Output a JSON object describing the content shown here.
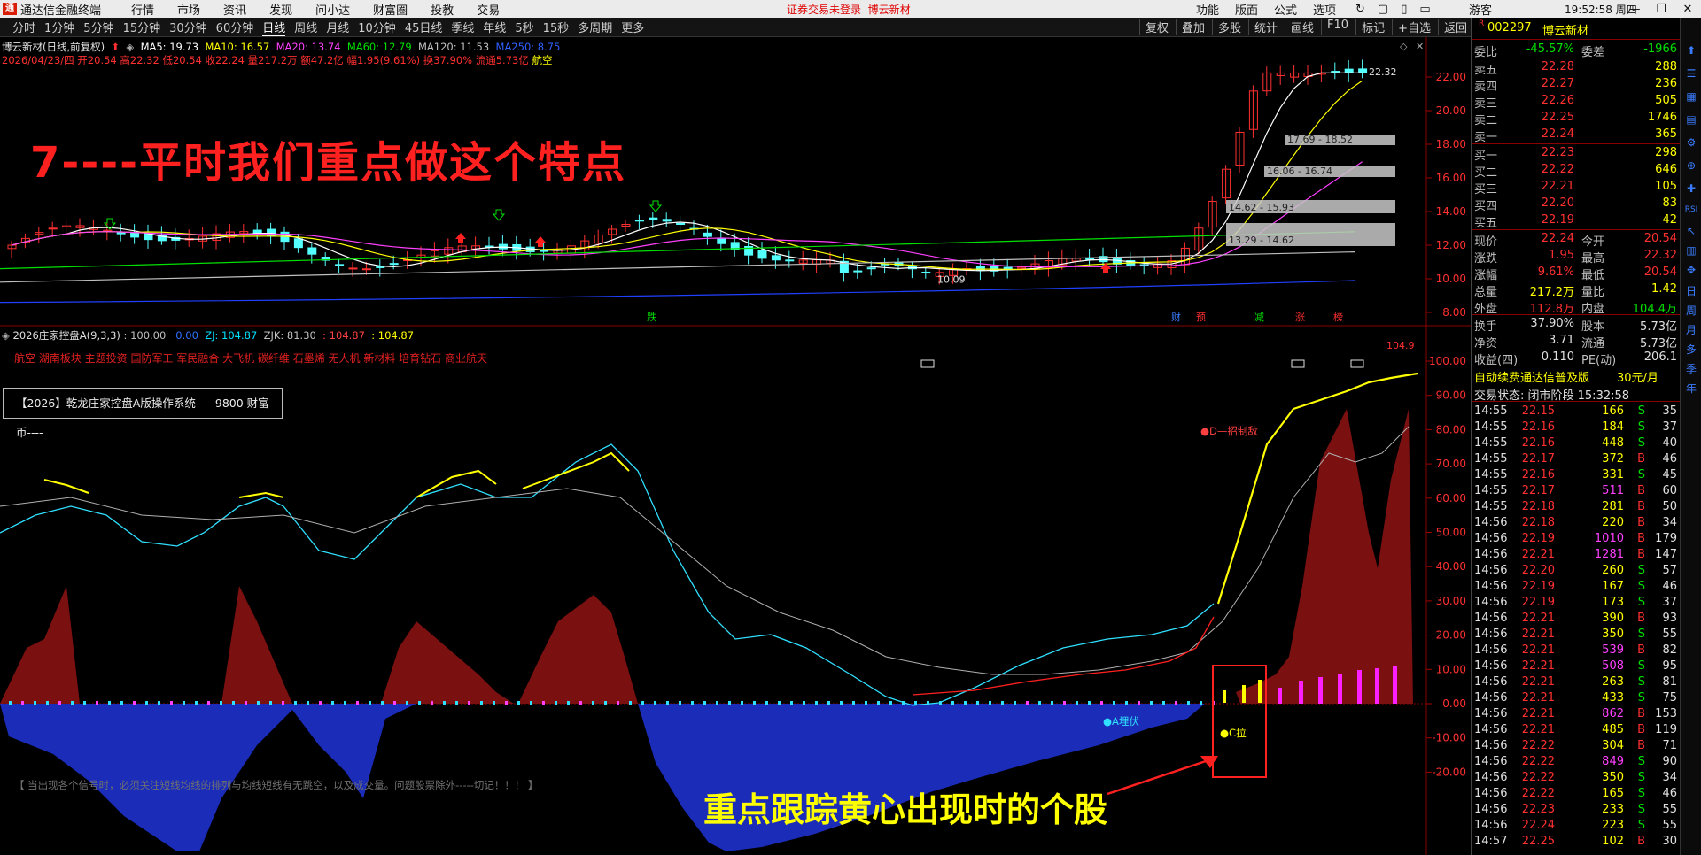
{
  "titlebar": {
    "app_name": "通达信金融终端",
    "menus": [
      "行情",
      "市场",
      "资讯",
      "发现",
      "问小达",
      "财富圈",
      "投教",
      "交易"
    ],
    "warning": "证券交易未登录",
    "stock_link": "博云新材",
    "right_menus": [
      "功能",
      "版面",
      "公式",
      "选项"
    ],
    "guest": "游客",
    "clock": "19:52:58 周四"
  },
  "periodbar": {
    "periods": [
      "分时",
      "1分钟",
      "5分钟",
      "15分钟",
      "30分钟",
      "60分钟",
      "日线",
      "周线",
      "月线",
      "10分钟",
      "45日线",
      "季线",
      "年线",
      "5秒",
      "15秒",
      "多周期",
      "更多"
    ],
    "active": "日线",
    "right_buttons": [
      "复权",
      "叠加",
      "多股",
      "统计",
      "画线",
      "F10",
      "标记",
      "+自选",
      "返回"
    ]
  },
  "main_chart": {
    "stock_title": "博云新材(日线,前复权)",
    "ma_labels": [
      "MA5: 19.73",
      "MA10: 16.57",
      "MA20: 13.74",
      "MA60: 12.79",
      "MA120: 11.53",
      "MA250: 8.75"
    ],
    "ma_colors": [
      "#ffffff",
      "#ffff00",
      "#ff40ff",
      "#00e000",
      "#c0c0c0",
      "#3060ff"
    ],
    "bar_info": "2026/04/23/四 开20.54 高22.32 低20.54 收22.24 量217.2万 额47.2亿 幅1.95(9.61%) 换37.90% 流通5.73亿",
    "bar_info_tag": "航空",
    "price_ticks": [
      "22.00",
      "20.00",
      "18.00",
      "16.00",
      "14.00",
      "12.00",
      "10.00",
      "8.00"
    ],
    "price_ticks_values": [
      22,
      20,
      18,
      16,
      14,
      12,
      10,
      8
    ],
    "high_label": "22.32",
    "low_label": "10.09",
    "chip_zones": [
      "17.69 - 18.52",
      "16.06 - 16.74",
      "14.62 - 15.93",
      "13.29 - 14.62"
    ],
    "event_tags": [
      "跌",
      "财",
      "预",
      "减",
      "涨",
      "榜"
    ],
    "big_title": "7----平时我们重点做这个特点"
  },
  "indicator": {
    "name": "2026庄家控盘A(9,3,3)",
    "values": [
      ": 100.00",
      "0.00",
      "ZJ: 104.87",
      "ZJK: 81.30",
      ": 104.87",
      ": 104.87"
    ],
    "value_colors": [
      "#c0c0c0",
      "#3070ff",
      "#00e0ff",
      "#c0c0c0",
      "#ff4040",
      "#ffff00"
    ],
    "concepts": "航空 湖南板块 主题投资 国防军工 军民融合 大飞机 碳纤维 石墨烯 无人机 新材料 培育钻石 商业航天",
    "system_box": "【2026】乾龙庄家控盘A版操作系统 ----9800 财富币----",
    "ticks": [
      "100.00",
      "90.00",
      "80.00",
      "70.00",
      "60.00",
      "50.00",
      "40.00",
      "30.00",
      "20.00",
      "10.00",
      "0.00",
      "-10.00",
      "-20.00"
    ],
    "ticks_values": [
      100,
      90,
      80,
      70,
      60,
      50,
      40,
      30,
      20,
      10,
      0,
      -10,
      -20
    ],
    "label_d": "●D—招制敌",
    "label_a": "●A埋伏",
    "label_c": "●C拉",
    "top_value": "104.9",
    "note": "【 当出现各个信号时，必须关注短线均线的排列与均线短线有无跳空，以及成交量。问题股票除外-----切记！！！ 】",
    "bottom_title": "重点跟踪黄心出现时的个股"
  },
  "quote": {
    "code": "002297",
    "name": "博云新材",
    "wb_label": "委比",
    "wb_value": "-45.57%",
    "wc_label": "委差",
    "wc_value": "-1966",
    "asks": [
      {
        "label": "卖五",
        "price": "22.28",
        "vol": "288"
      },
      {
        "label": "卖四",
        "price": "22.27",
        "vol": "236"
      },
      {
        "label": "卖三",
        "price": "22.26",
        "vol": "505"
      },
      {
        "label": "卖二",
        "price": "22.25",
        "vol": "1746"
      },
      {
        "label": "卖一",
        "price": "22.24",
        "vol": "365"
      }
    ],
    "bids": [
      {
        "label": "买一",
        "price": "22.23",
        "vol": "298"
      },
      {
        "label": "买二",
        "price": "22.22",
        "vol": "646"
      },
      {
        "label": "买三",
        "price": "22.21",
        "vol": "105"
      },
      {
        "label": "买四",
        "price": "22.20",
        "vol": "83"
      },
      {
        "label": "买五",
        "price": "22.19",
        "vol": "42"
      }
    ],
    "stats": [
      {
        "l1": "现价",
        "v1": "22.24",
        "l2": "今开",
        "v2": "20.54"
      },
      {
        "l1": "涨跌",
        "v1": "1.95",
        "l2": "最高",
        "v2": "22.32"
      },
      {
        "l1": "涨幅",
        "v1": "9.61%",
        "l2": "最低",
        "v2": "20.54"
      },
      {
        "l1": "总量",
        "v1": "217.2万",
        "l2": "量比",
        "v2": "1.42"
      },
      {
        "l1": "外盘",
        "v1": "112.8万",
        "l2": "内盘",
        "v2": "104.4万"
      },
      {
        "l1": "换手",
        "v1": "37.90%",
        "l2": "股本",
        "v2": "5.73亿"
      },
      {
        "l1": "净资",
        "v1": "3.71",
        "l2": "流通",
        "v2": "5.73亿"
      },
      {
        "l1": "收益(四)",
        "v1": "0.110",
        "l2": "PE(动)",
        "v2": "206.1"
      }
    ],
    "ad_text": "自动续费通达信普及版",
    "ad_price": "30元/月",
    "trade_status": "交易状态: 闭市阶段 15:32:58",
    "ticks": [
      [
        "14:55",
        "22.15",
        "166",
        "S",
        "35"
      ],
      [
        "14:55",
        "22.16",
        "184",
        "S",
        "37"
      ],
      [
        "14:55",
        "22.16",
        "448",
        "S",
        "40"
      ],
      [
        "14:55",
        "22.17",
        "372",
        "B",
        "46"
      ],
      [
        "14:55",
        "22.16",
        "331",
        "S",
        "45"
      ],
      [
        "14:55",
        "22.17",
        "511",
        "B",
        "60"
      ],
      [
        "14:55",
        "22.18",
        "281",
        "B",
        "50"
      ],
      [
        "14:56",
        "22.18",
        "220",
        "B",
        "34"
      ],
      [
        "14:56",
        "22.19",
        "1010",
        "B",
        "179"
      ],
      [
        "14:56",
        "22.21",
        "1281",
        "B",
        "147"
      ],
      [
        "14:56",
        "22.20",
        "260",
        "S",
        "57"
      ],
      [
        "14:56",
        "22.19",
        "167",
        "S",
        "46"
      ],
      [
        "14:56",
        "22.19",
        "173",
        "S",
        "37"
      ],
      [
        "14:56",
        "22.21",
        "390",
        "B",
        "93"
      ],
      [
        "14:56",
        "22.21",
        "350",
        "S",
        "55"
      ],
      [
        "14:56",
        "22.21",
        "539",
        "B",
        "82"
      ],
      [
        "14:56",
        "22.21",
        "508",
        "S",
        "95"
      ],
      [
        "14:56",
        "22.21",
        "263",
        "S",
        "81"
      ],
      [
        "14:56",
        "22.21",
        "433",
        "S",
        "75"
      ],
      [
        "14:56",
        "22.21",
        "862",
        "B",
        "153"
      ],
      [
        "14:56",
        "22.21",
        "485",
        "B",
        "119"
      ],
      [
        "14:56",
        "22.22",
        "304",
        "B",
        "71"
      ],
      [
        "14:56",
        "22.22",
        "849",
        "S",
        "90"
      ],
      [
        "14:56",
        "22.22",
        "350",
        "S",
        "34"
      ],
      [
        "14:56",
        "22.22",
        "165",
        "S",
        "46"
      ],
      [
        "14:56",
        "22.23",
        "233",
        "S",
        "55"
      ],
      [
        "14:56",
        "22.24",
        "223",
        "S",
        "55"
      ],
      [
        "14:57",
        "22.25",
        "102",
        "B",
        "30"
      ]
    ],
    "tick_colors": {
      "buy": "#ff3030",
      "sell": "#00e000",
      "up": "#ff3030",
      "flat": "#e0e0e0"
    }
  },
  "sidebar_icons": [
    "up-arrow-icon",
    "list-icon",
    "chart-icon",
    "grid-icon",
    "settings-icon",
    "zoom-icon",
    "cross-icon",
    "rsi-icon",
    "cursor-icon",
    "tile-icon",
    "move-icon",
    "day-icon",
    "week-icon",
    "month-icon",
    "multi-icon",
    "quarter-icon",
    "year-icon"
  ],
  "sidebar_labels": [
    "RSI",
    "日",
    "周",
    "月",
    "多",
    "季",
    "年"
  ]
}
